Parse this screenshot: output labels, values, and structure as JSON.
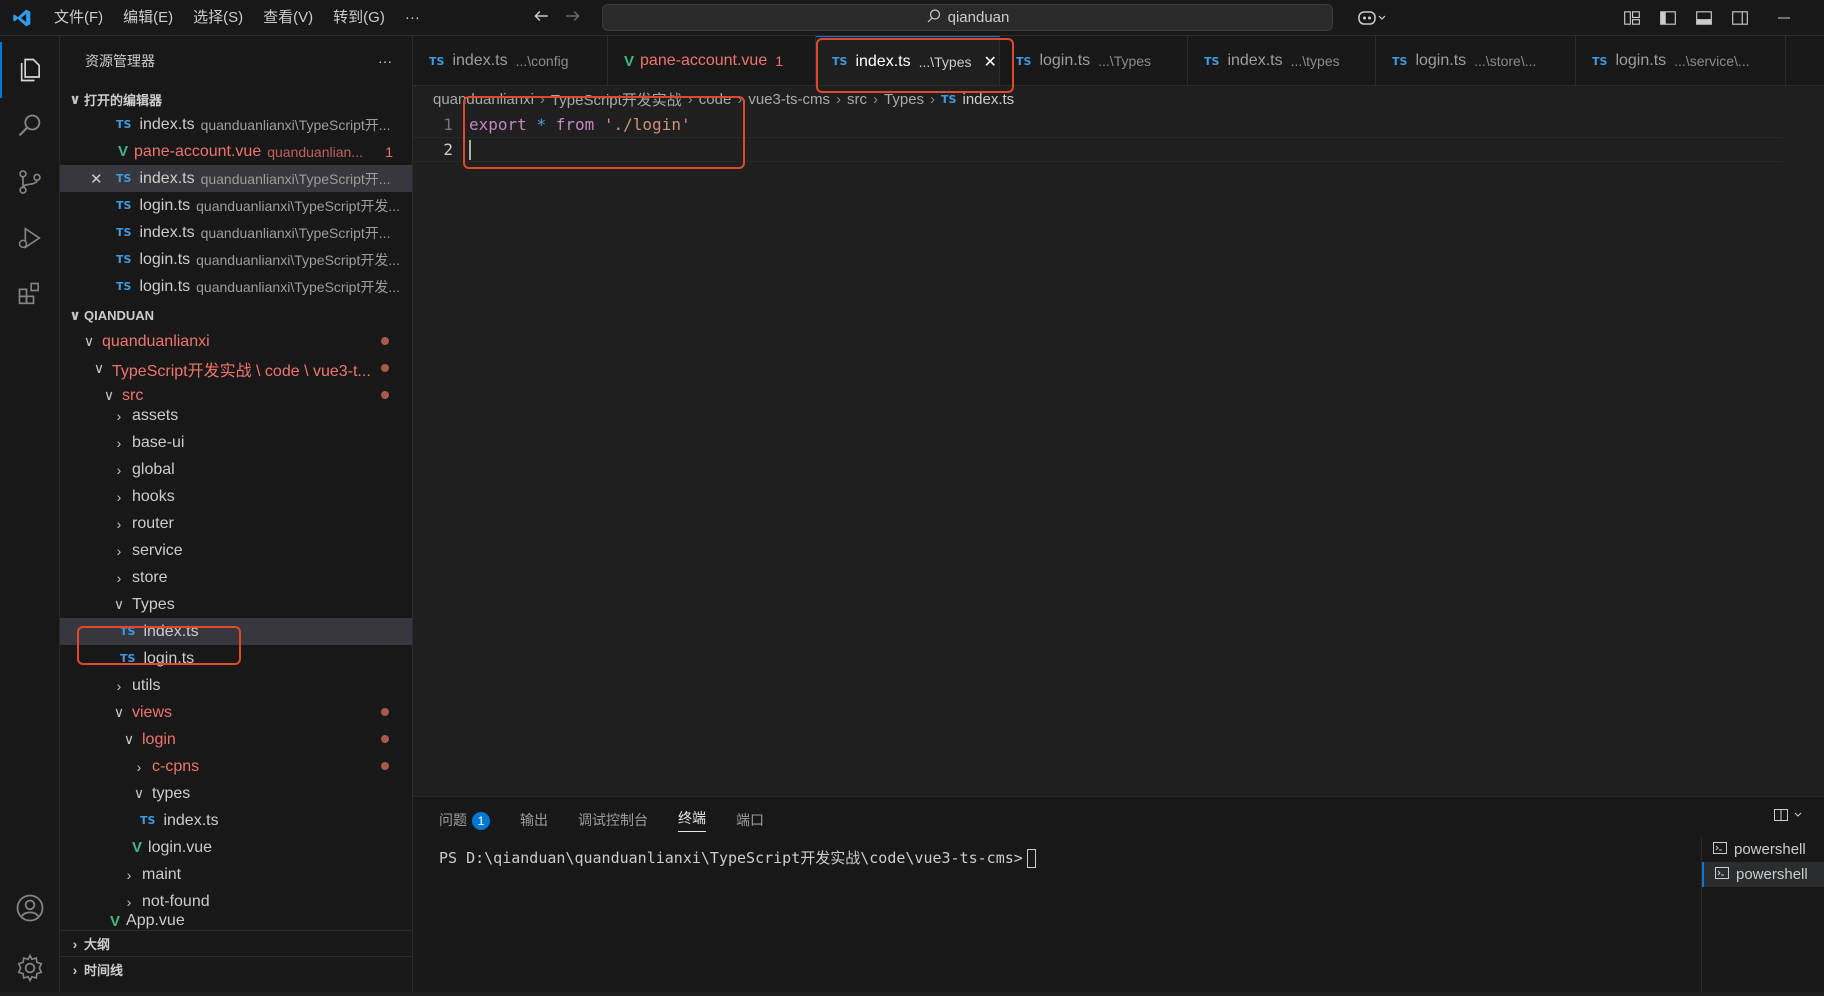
{
  "menu": [
    "文件(F)",
    "编辑(E)",
    "选择(S)",
    "查看(V)",
    "转到(G)",
    "···"
  ],
  "search": {
    "text": "qianduan"
  },
  "sidebar": {
    "title": "资源管理器",
    "more": "···",
    "open_editors": {
      "label": "打开的编辑器",
      "items": [
        {
          "name": "index.ts",
          "desc": "quanduanlianxi\\TypeScript开..."
        },
        {
          "name": "pane-account.vue",
          "desc": "quanduanlian...",
          "badge": "1"
        },
        {
          "name": "index.ts",
          "desc": "quanduanlianxi\\TypeScript开..."
        },
        {
          "name": "login.ts",
          "desc": "quanduanlianxi\\TypeScript开发..."
        },
        {
          "name": "index.ts",
          "desc": "quanduanlianxi\\TypeScript开..."
        },
        {
          "name": "login.ts",
          "desc": "quanduanlianxi\\TypeScript开发..."
        },
        {
          "name": "login.ts",
          "desc": "quanduanlianxi\\TypeScript开发..."
        }
      ]
    },
    "workspace": {
      "label": "QIANDUAN",
      "tree": [
        "quanduanlianxi",
        "TypeScript开发实战 \\ code \\ vue3-t...",
        "src",
        "assets",
        "base-ui",
        "global",
        "hooks",
        "router",
        "service",
        "store",
        "Types",
        "index.ts",
        "login.ts",
        "utils",
        "views",
        "login",
        "c-cpns",
        "types",
        "index.ts",
        "login.vue",
        "maint",
        "not-found",
        "App.vue"
      ]
    },
    "outline": "大纲",
    "timeline": "时间线"
  },
  "tabs": [
    {
      "name": "index.ts",
      "desc": "...\\config"
    },
    {
      "name": "pane-account.vue",
      "desc": "1"
    },
    {
      "name": "index.ts",
      "desc": "...\\Types"
    },
    {
      "name": "login.ts",
      "desc": "...\\Types"
    },
    {
      "name": "index.ts",
      "desc": "...\\types"
    },
    {
      "name": "login.ts",
      "desc": "...\\store\\..."
    },
    {
      "name": "login.ts",
      "desc": "...\\service\\..."
    }
  ],
  "breadcrumb": [
    "quanduanlianxi",
    "TypeScript开发实战",
    "code",
    "vue3-ts-cms",
    "src",
    "Types",
    "index.ts"
  ],
  "code": {
    "line1_num": "1",
    "line2_num": "2",
    "kw_export": "export",
    "op_star": "*",
    "kw_from": "from",
    "str_path": "'./login'"
  },
  "panel": {
    "tabs": [
      "问题",
      "输出",
      "调试控制台",
      "终端",
      "端口"
    ],
    "problems_count": "1",
    "terminal_prompt": "PS D:\\qianduan\\quanduanlianxi\\TypeScript开发实战\\code\\vue3-ts-cms>",
    "terminals": [
      "powershell",
      "powershell"
    ]
  },
  "colors": {
    "accent": "#0078d4",
    "highlight": "#e0482d",
    "modified": "#f0746c"
  }
}
